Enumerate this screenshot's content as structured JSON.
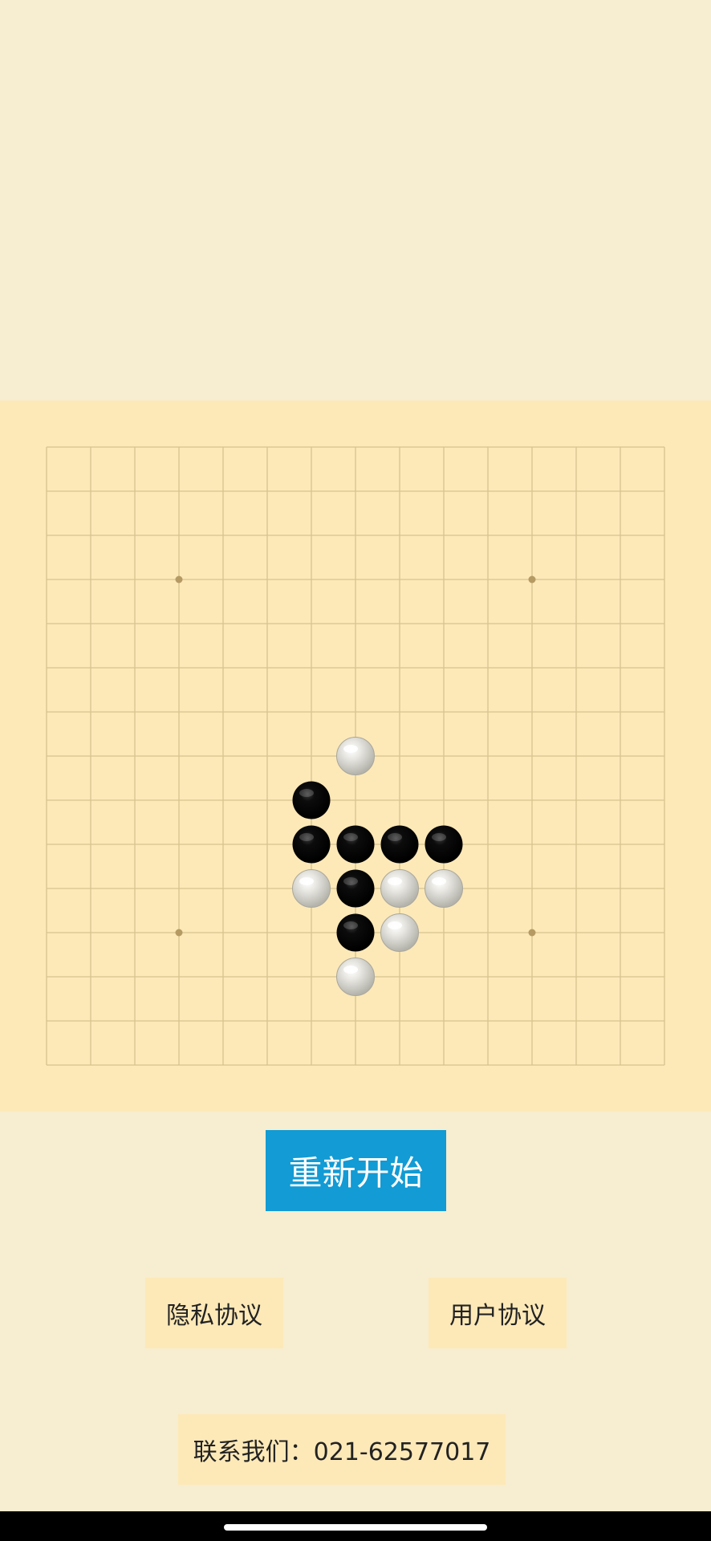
{
  "board": {
    "size": 15,
    "stones": [
      {
        "color": "white",
        "col": 7,
        "row": 7
      },
      {
        "color": "black",
        "col": 6,
        "row": 8
      },
      {
        "color": "black",
        "col": 6,
        "row": 9
      },
      {
        "color": "black",
        "col": 7,
        "row": 9
      },
      {
        "color": "black",
        "col": 8,
        "row": 9
      },
      {
        "color": "black",
        "col": 9,
        "row": 9
      },
      {
        "color": "white",
        "col": 6,
        "row": 10
      },
      {
        "color": "black",
        "col": 7,
        "row": 10
      },
      {
        "color": "white",
        "col": 8,
        "row": 10
      },
      {
        "color": "white",
        "col": 9,
        "row": 10
      },
      {
        "color": "black",
        "col": 7,
        "row": 11
      },
      {
        "color": "white",
        "col": 8,
        "row": 11
      },
      {
        "color": "white",
        "col": 7,
        "row": 12
      }
    ],
    "star_points": [
      {
        "col": 3,
        "row": 3
      },
      {
        "col": 11,
        "row": 3
      },
      {
        "col": 3,
        "row": 11
      },
      {
        "col": 11,
        "row": 11
      }
    ],
    "colors": {
      "background": "#fde9b8",
      "grid_line": "#d7c38d",
      "star_point": "#b59a63"
    }
  },
  "controls": {
    "restart_label": "重新开始",
    "privacy_label": "隐私协议",
    "terms_label": "用户协议",
    "contact_label": "联系我们：021-62577017"
  },
  "colors": {
    "page_background": "#f7edd0",
    "restart_button": "#129bd4",
    "link_button": "#fde9b8"
  }
}
